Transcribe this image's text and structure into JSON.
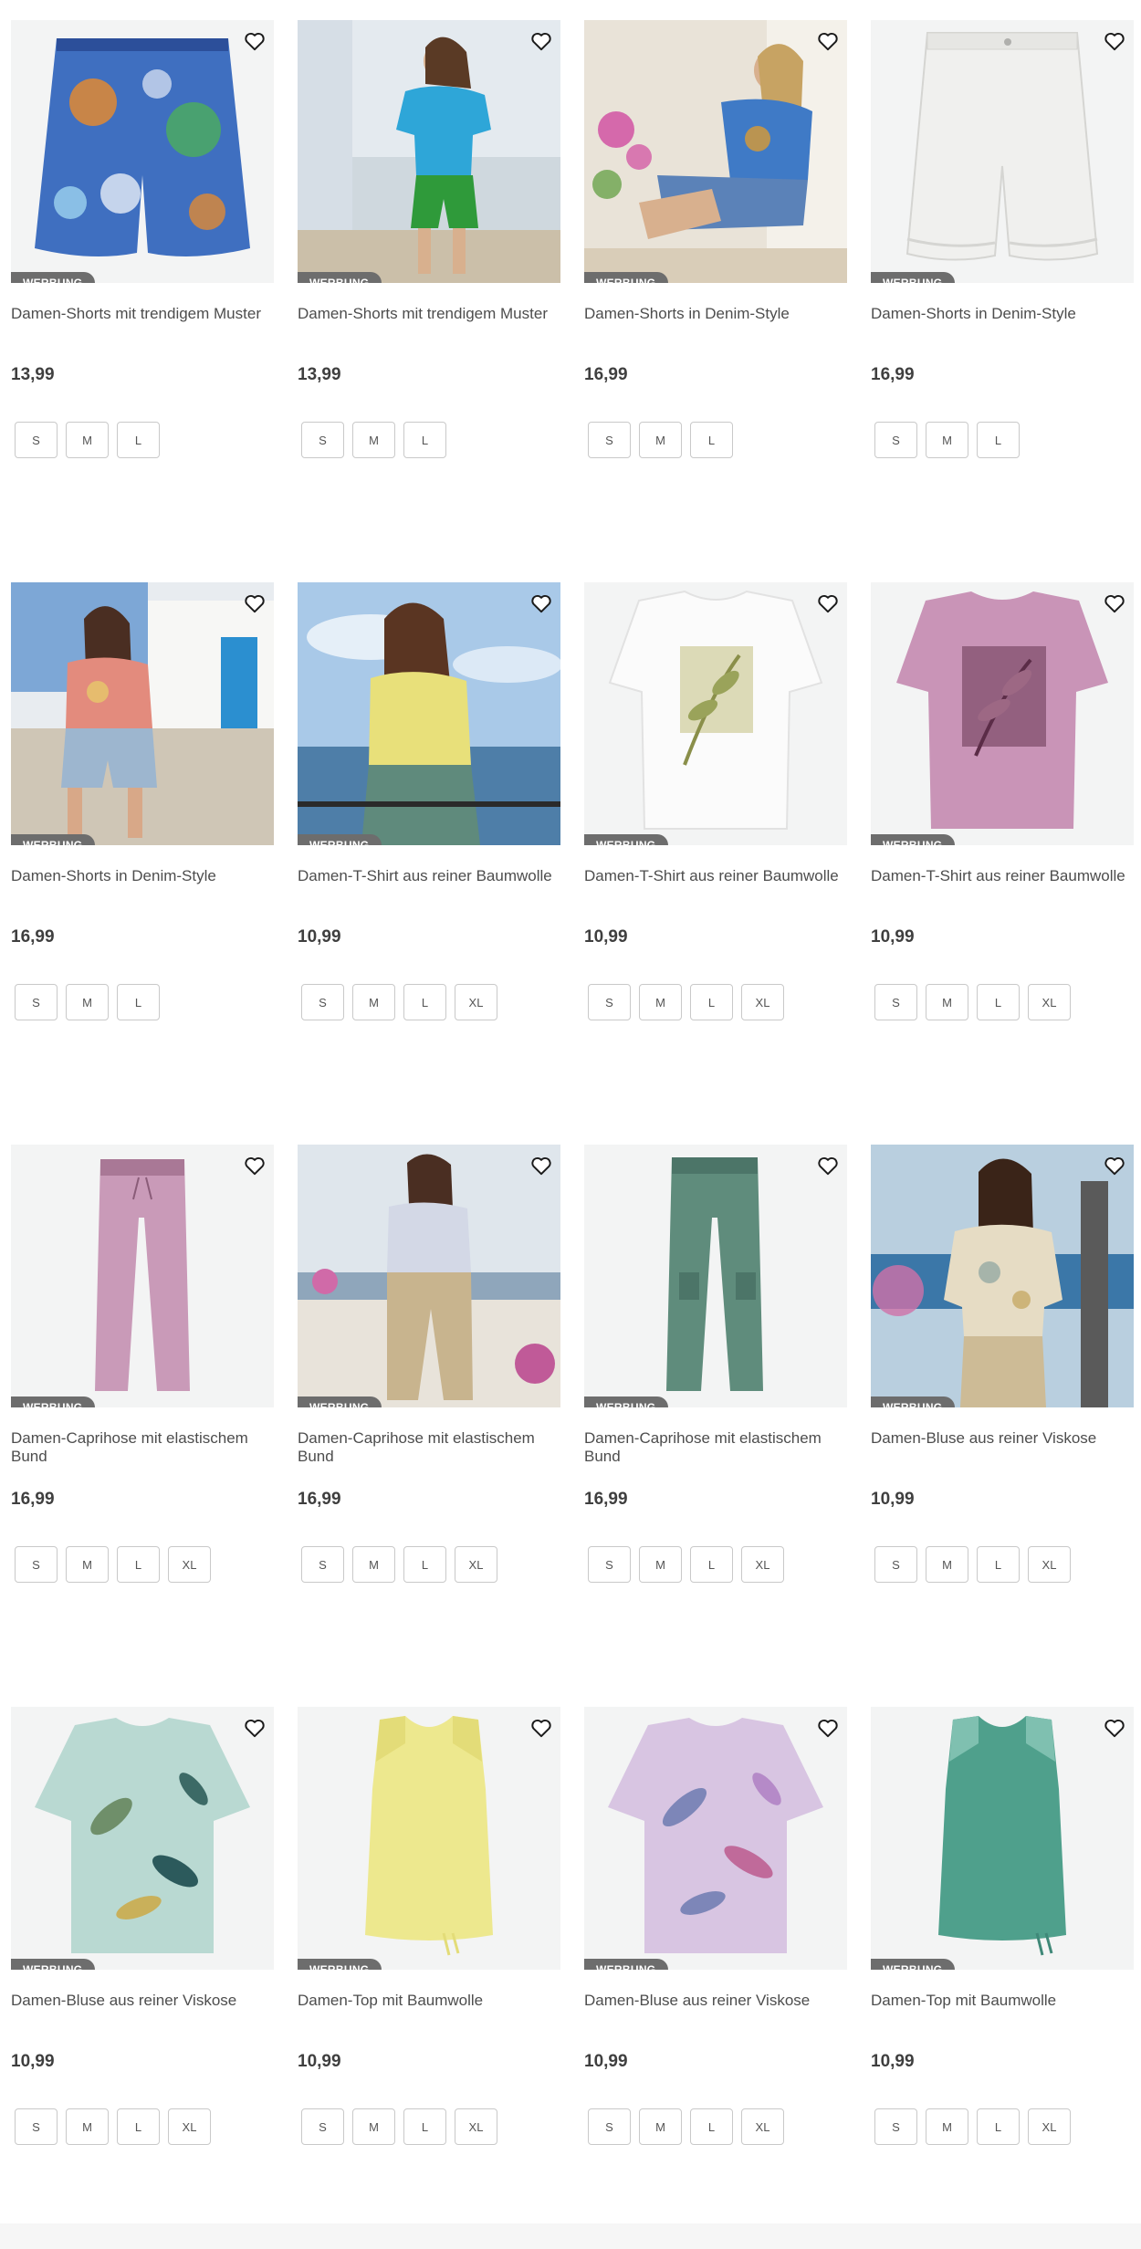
{
  "products": [
    {
      "title": "Damen-Shorts mit trendigem Muster",
      "price": "13,99",
      "badge": "WERBUNG",
      "sizes": [
        "S",
        "M",
        "L"
      ],
      "art": "shorts-paisley",
      "colors": {
        "main": "#3f6fc0",
        "accent": "#e08a33",
        "bg": "#f3f4f4"
      }
    },
    {
      "title": "Damen-Shorts mit trendigem Muster",
      "price": "13,99",
      "badge": "WERBUNG",
      "sizes": [
        "S",
        "M",
        "L"
      ],
      "art": "model-blue-top",
      "colors": {
        "main": "#2ea6d8",
        "accent": "#2f9a3a",
        "bg": "#cfd8de"
      }
    },
    {
      "title": "Damen-Shorts in Denim-Style",
      "price": "16,99",
      "badge": "WERBUNG",
      "sizes": [
        "S",
        "M",
        "L"
      ],
      "art": "model-denim-sitting",
      "colors": {
        "main": "#5b82b8",
        "accent": "#d04aa0",
        "bg": "#e9e3d8"
      }
    },
    {
      "title": "Damen-Shorts in Denim-Style",
      "price": "16,99",
      "badge": "WERBUNG",
      "sizes": [
        "S",
        "M",
        "L"
      ],
      "art": "shorts-white",
      "colors": {
        "main": "#f0f0ee",
        "accent": "#d5d5d2",
        "bg": "#f3f4f4"
      }
    },
    {
      "title": "Damen-Shorts in Denim-Style",
      "price": "16,99",
      "badge": "WERBUNG",
      "sizes": [
        "S",
        "M",
        "L"
      ],
      "art": "model-denim-house",
      "colors": {
        "main": "#9db6cf",
        "accent": "#e38b7d",
        "bg": "#e8ecf0"
      }
    },
    {
      "title": "Damen-T-Shirt aus reiner Baumwolle",
      "price": "10,99",
      "badge": "WERBUNG",
      "sizes": [
        "S",
        "M",
        "L",
        "XL"
      ],
      "art": "model-yellow-sea",
      "colors": {
        "main": "#e8e07a",
        "accent": "#5f8a7c",
        "bg": "#a9c9e8"
      }
    },
    {
      "title": "Damen-T-Shirt aus reiner Baumwolle",
      "price": "10,99",
      "badge": "WERBUNG",
      "sizes": [
        "S",
        "M",
        "L",
        "XL"
      ],
      "art": "tshirt-white-leaf",
      "colors": {
        "main": "#fbfbfb",
        "accent": "#c8c48a",
        "bg": "#f3f4f4"
      }
    },
    {
      "title": "Damen-T-Shirt aus reiner Baumwolle",
      "price": "10,99",
      "badge": "WERBUNG",
      "sizes": [
        "S",
        "M",
        "L",
        "XL"
      ],
      "art": "tshirt-pink-leaf",
      "colors": {
        "main": "#c994b7",
        "accent": "#7c4a66",
        "bg": "#f3f4f4"
      }
    },
    {
      "title": "Damen-Caprihose mit elastischem Bund",
      "price": "16,99",
      "badge": "WERBUNG",
      "sizes": [
        "S",
        "M",
        "L",
        "XL"
      ],
      "art": "pants-pink",
      "colors": {
        "main": "#c99ab8",
        "accent": "#a97896",
        "bg": "#f3f4f4"
      }
    },
    {
      "title": "Damen-Caprihose mit elastischem Bund",
      "price": "16,99",
      "badge": "WERBUNG",
      "sizes": [
        "S",
        "M",
        "L",
        "XL"
      ],
      "art": "model-beige-pants",
      "colors": {
        "main": "#c8b48e",
        "accent": "#d3d8e6",
        "bg": "#dfe6ec"
      }
    },
    {
      "title": "Damen-Caprihose mit elastischem Bund",
      "price": "16,99",
      "badge": "WERBUNG",
      "sizes": [
        "S",
        "M",
        "L",
        "XL"
      ],
      "art": "pants-green",
      "colors": {
        "main": "#5f8c7c",
        "accent": "#4c7568",
        "bg": "#f3f4f4"
      }
    },
    {
      "title": "Damen-Bluse aus reiner Viskose",
      "price": "10,99",
      "badge": "WERBUNG",
      "sizes": [
        "S",
        "M",
        "L",
        "XL"
      ],
      "art": "model-viscose-blouse",
      "colors": {
        "main": "#e6dcc4",
        "accent": "#8aa3a0",
        "bg": "#b9cfdf"
      }
    },
    {
      "title": "Damen-Bluse aus reiner Viskose",
      "price": "10,99",
      "badge": "WERBUNG",
      "sizes": [
        "S",
        "M",
        "L",
        "XL"
      ],
      "art": "blouse-mint",
      "colors": {
        "main": "#b9d9d2",
        "accent": "#6f8f6a",
        "bg": "#f3f4f4"
      }
    },
    {
      "title": "Damen-Top mit Baumwolle",
      "price": "10,99",
      "badge": "WERBUNG",
      "sizes": [
        "S",
        "M",
        "L",
        "XL"
      ],
      "art": "top-yellow",
      "colors": {
        "main": "#ede88e",
        "accent": "#e3dc78",
        "bg": "#f3f4f4"
      }
    },
    {
      "title": "Damen-Bluse aus reiner Viskose",
      "price": "10,99",
      "badge": "WERBUNG",
      "sizes": [
        "S",
        "M",
        "L",
        "XL"
      ],
      "art": "blouse-lilac",
      "colors": {
        "main": "#d8c5e2",
        "accent": "#7d86b8",
        "bg": "#f3f4f4"
      }
    },
    {
      "title": "Damen-Top mit Baumwolle",
      "price": "10,99",
      "badge": "WERBUNG",
      "sizes": [
        "S",
        "M",
        "L",
        "XL"
      ],
      "art": "top-green",
      "colors": {
        "main": "#4fa08c",
        "accent": "#3f8878",
        "bg": "#f3f4f4"
      }
    }
  ],
  "icons": {
    "favorite": "heart-outline-icon"
  }
}
